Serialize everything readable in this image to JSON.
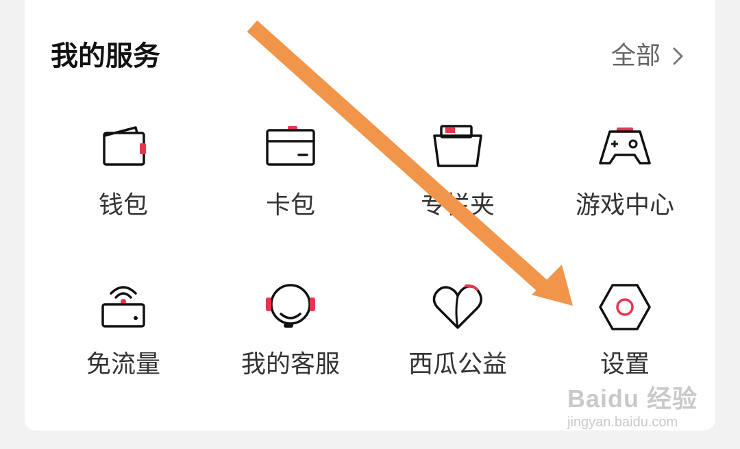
{
  "section": {
    "title": "我的服务",
    "more_label": "全部"
  },
  "services": [
    {
      "label": "钱包",
      "icon": "wallet-icon"
    },
    {
      "label": "卡包",
      "icon": "card-holder-icon"
    },
    {
      "label": "专栏夹",
      "icon": "column-folder-icon"
    },
    {
      "label": "游戏中心",
      "icon": "gamepad-icon"
    },
    {
      "label": "免流量",
      "icon": "free-data-router-icon"
    },
    {
      "label": "我的客服",
      "icon": "headset-icon"
    },
    {
      "label": "西瓜公益",
      "icon": "heart-icon"
    },
    {
      "label": "设置",
      "icon": "settings-hexagon-icon"
    }
  ],
  "annotation": {
    "type": "arrow",
    "color": "#f0954a",
    "points_to": "设置"
  },
  "watermark": {
    "brand": "Baidu 经验",
    "url": "jingyan.baidu.com"
  },
  "colors": {
    "accent": "#e8344e",
    "icon_stroke": "#111111",
    "arrow": "#f0954a"
  }
}
